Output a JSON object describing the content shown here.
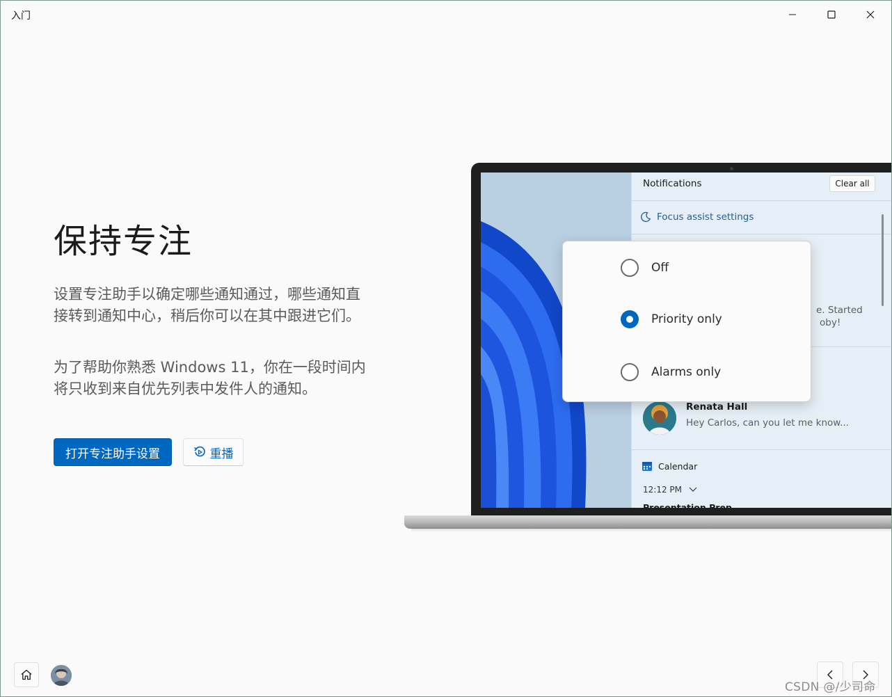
{
  "window": {
    "title": "入门"
  },
  "content": {
    "heading": "保持专注",
    "paragraph1": "设置专注助手以确定哪些通知通过，哪些通知直接转到通知中心，稍后你可以在其中跟进它们。",
    "paragraph2": "为了帮助你熟悉 Windows 11，你在一段时间内将只收到来自优先列表中发件人的通知。",
    "primary_button": "打开专注助手设置",
    "replay_button": "重播"
  },
  "illustration": {
    "notifications_title": "Notifications",
    "clear_all": "Clear all",
    "focus_assist_settings": "Focus assist settings",
    "partial_text_1": "e. Started",
    "partial_text_2": "oby!",
    "message": {
      "sender": "Renata Hall",
      "preview": "Hey Carlos, can you let me know..."
    },
    "calendar": {
      "app": "Calendar",
      "time": "12:12 PM",
      "event": "Presentation Prep"
    },
    "focus_options": [
      {
        "label": "Off",
        "selected": false
      },
      {
        "label": "Priority only",
        "selected": true
      },
      {
        "label": "Alarms only",
        "selected": false
      }
    ]
  },
  "footer": {
    "watermark": "CSDN @/少司命"
  },
  "colors": {
    "accent": "#0067c0",
    "background": "#fafafa"
  }
}
